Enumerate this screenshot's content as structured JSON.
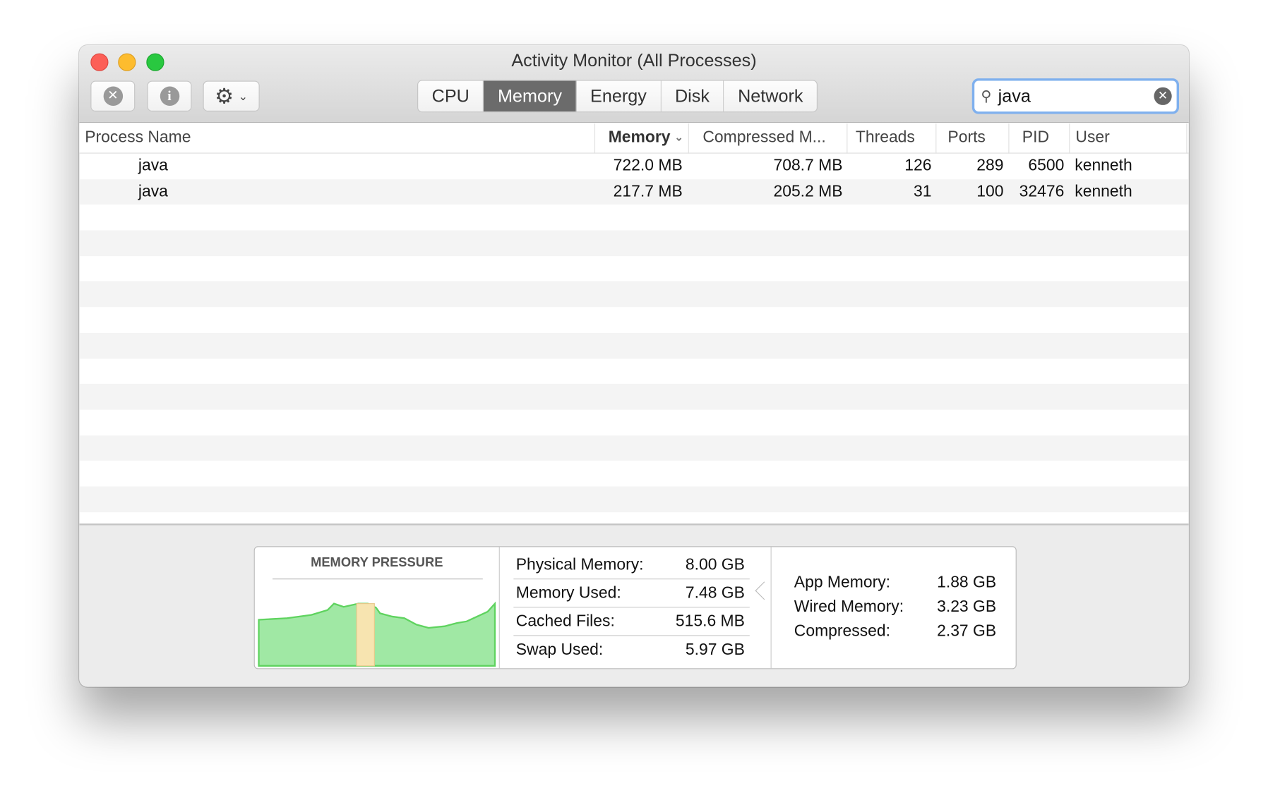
{
  "window": {
    "title": "Activity Monitor (All Processes)"
  },
  "toolbar": {
    "stop_icon": "x-circle-icon",
    "info_icon": "info-icon",
    "gear_icon": "gear-icon",
    "tabs": [
      {
        "label": "CPU"
      },
      {
        "label": "Memory",
        "active": true
      },
      {
        "label": "Energy"
      },
      {
        "label": "Disk"
      },
      {
        "label": "Network"
      }
    ],
    "search": {
      "value": "java"
    }
  },
  "table": {
    "columns": [
      "Process Name",
      "Memory",
      "Compressed M...",
      "Threads",
      "Ports",
      "PID",
      "User"
    ],
    "sort": {
      "column": "Memory",
      "direction": "descending"
    },
    "rows": [
      {
        "name": "java",
        "memory": "722.0 MB",
        "compressed": "708.7 MB",
        "threads": "126",
        "ports": "289",
        "pid": "6500",
        "user": "kenneth"
      },
      {
        "name": "java",
        "memory": "217.7 MB",
        "compressed": "205.2 MB",
        "threads": "31",
        "ports": "100",
        "pid": "32476",
        "user": "kenneth"
      }
    ]
  },
  "summary": {
    "pressure_label": "MEMORY PRESSURE",
    "pressure_color": "#5fd35f",
    "pressure_highlight": "#f7e4b0",
    "stats": [
      {
        "label": "Physical Memory:",
        "value": "8.00 GB"
      },
      {
        "label": "Memory Used:",
        "value": "7.48 GB"
      },
      {
        "label": "Cached Files:",
        "value": "515.6 MB"
      },
      {
        "label": "Swap Used:",
        "value": "5.97 GB"
      }
    ],
    "breakdown": [
      {
        "label": "App Memory:",
        "value": "1.88 GB"
      },
      {
        "label": "Wired Memory:",
        "value": "3.23 GB"
      },
      {
        "label": "Compressed:",
        "value": "2.37 GB"
      }
    ]
  }
}
